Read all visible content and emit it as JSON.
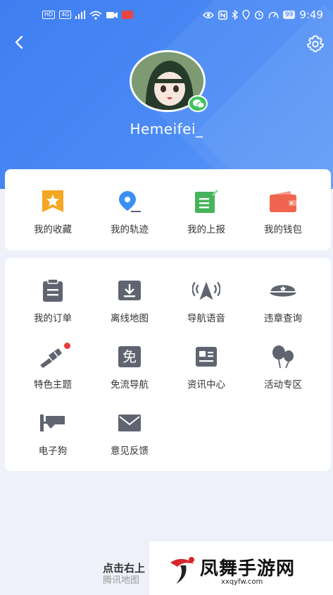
{
  "status_bar": {
    "hd": "HD",
    "network": "4G",
    "battery": "99",
    "time": "9:49"
  },
  "profile": {
    "username": "Hemeifei_"
  },
  "quick_items": [
    {
      "label": "我的收藏",
      "icon": "star-bookmark-icon",
      "color": "#f5a623"
    },
    {
      "label": "我的轨迹",
      "icon": "location-pin-icon",
      "color": "#3a8ff5"
    },
    {
      "label": "我的上报",
      "icon": "report-edit-icon",
      "color": "#46b45a"
    },
    {
      "label": "我的钱包",
      "icon": "wallet-icon",
      "color": "#f0654f"
    }
  ],
  "menu_items": [
    {
      "label": "我的订单",
      "icon": "clipboard-icon"
    },
    {
      "label": "离线地图",
      "icon": "download-map-icon"
    },
    {
      "label": "导航语音",
      "icon": "voice-navigation-icon"
    },
    {
      "label": "违章查询",
      "icon": "police-cap-icon"
    },
    {
      "label": "特色主题",
      "icon": "paint-brush-icon"
    },
    {
      "label": "免流导航",
      "icon": "free-data-icon",
      "glyph": "免"
    },
    {
      "label": "资讯中心",
      "icon": "news-icon"
    },
    {
      "label": "活动专区",
      "icon": "balloons-icon"
    },
    {
      "label": "电子狗",
      "icon": "camera-icon"
    },
    {
      "label": "意见反馈",
      "icon": "envelope-icon"
    }
  ],
  "bottom": {
    "hint": "点击右上",
    "brand": "腾讯地图"
  },
  "watermark": {
    "title": "凤舞手游网",
    "url": "xxqyfw.com"
  },
  "colors": {
    "header_blue": "#3f7ef0",
    "icon_gray": "#5f6470",
    "badge_red": "#e63b3b"
  }
}
